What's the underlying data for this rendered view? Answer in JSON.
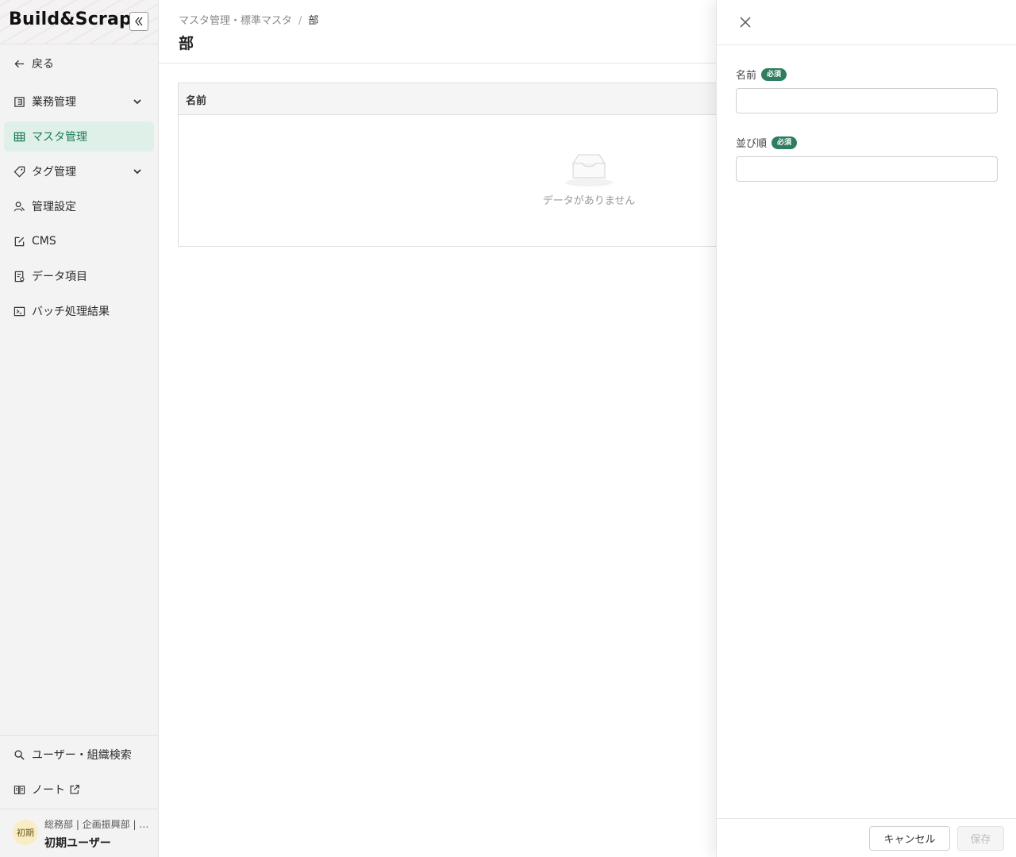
{
  "sidebar": {
    "logo": "Build&Scrap",
    "collapse_icon": "double-chevron-left-icon",
    "items": [
      {
        "label": "戻る",
        "icon": "arrow-left-icon"
      },
      {
        "label": "業務管理",
        "icon": "document-icon",
        "expandable": true
      },
      {
        "label": "マスタ管理",
        "icon": "table-icon",
        "active": true
      },
      {
        "label": "タグ管理",
        "icon": "tag-icon",
        "expandable": true
      },
      {
        "label": "管理設定",
        "icon": "user-settings-icon"
      },
      {
        "label": "CMS",
        "icon": "edit-icon"
      },
      {
        "label": "データ項目",
        "icon": "data-file-icon"
      },
      {
        "label": "バッチ処理結果",
        "icon": "terminal-icon"
      }
    ],
    "bottom_items": [
      {
        "label": "ユーザー・組織検索",
        "icon": "search-icon"
      },
      {
        "label": "ノート",
        "icon": "book-icon",
        "external": true
      }
    ],
    "user": {
      "avatar_text": "初期",
      "org": "総務部 | 企画振興部 | …",
      "name": "初期ユーザー"
    }
  },
  "main": {
    "breadcrumb": {
      "parent": "マスタ管理・標準マスタ",
      "separator": "/",
      "current": "部"
    },
    "title": "部",
    "table": {
      "columns": [
        "名前"
      ],
      "empty_text": "データがありません"
    }
  },
  "drawer": {
    "fields": [
      {
        "label": "名前",
        "required_badge": "必須",
        "value": ""
      },
      {
        "label": "並び順",
        "required_badge": "必須",
        "value": ""
      }
    ],
    "cancel_label": "キャンセル",
    "save_label": "保存"
  },
  "colors": {
    "accent": "#1c7a58",
    "active_bg": "#dff0e9",
    "badge": "#2f7d5e",
    "avatar_bg": "#faedc4"
  }
}
